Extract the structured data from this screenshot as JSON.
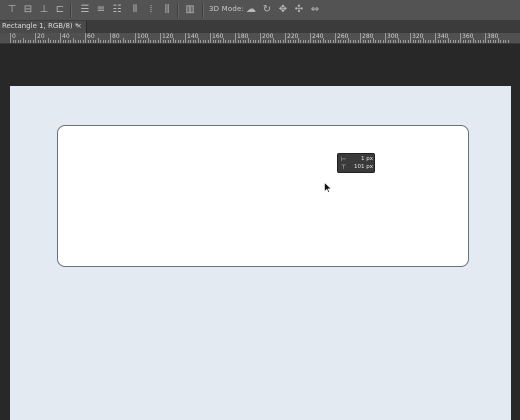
{
  "toolbar": {
    "mode_label": "3D Mode:",
    "align_icons": [
      "align-top-edges-icon",
      "align-vertical-centers-icon",
      "align-bottom-edges-icon",
      "align-left-edges-icon",
      "align-horizontal-centers-icon",
      "align-right-edges-icon"
    ],
    "distribute_icons": [
      "distribute-top-icon",
      "distribute-vcenter-icon",
      "distribute-bottom-icon",
      "distribute-left-icon",
      "distribute-hcenter-icon",
      "distribute-right-icon"
    ],
    "3d_icons": [
      "orbit-3d-icon",
      "roll-3d-icon",
      "pan-3d-icon",
      "slide-3d-icon",
      "scale-3d-icon"
    ]
  },
  "document_tab": {
    "label": "Rectangle 1, RGB/8) *",
    "close": "×"
  },
  "ruler": {
    "labels": [
      "0",
      "20",
      "40",
      "60",
      "80",
      "100",
      "120",
      "140",
      "160",
      "180",
      "200",
      "220",
      "240",
      "260",
      "280",
      "300",
      "320",
      "340",
      "360",
      "380"
    ]
  },
  "tooltip": {
    "width_value": "1 px",
    "height_value": "101 px"
  },
  "colors": {
    "canvas": "#e4eaf2",
    "shape_fill": "#ffffff",
    "shape_stroke": "#6e7077",
    "chrome": "#535353"
  }
}
